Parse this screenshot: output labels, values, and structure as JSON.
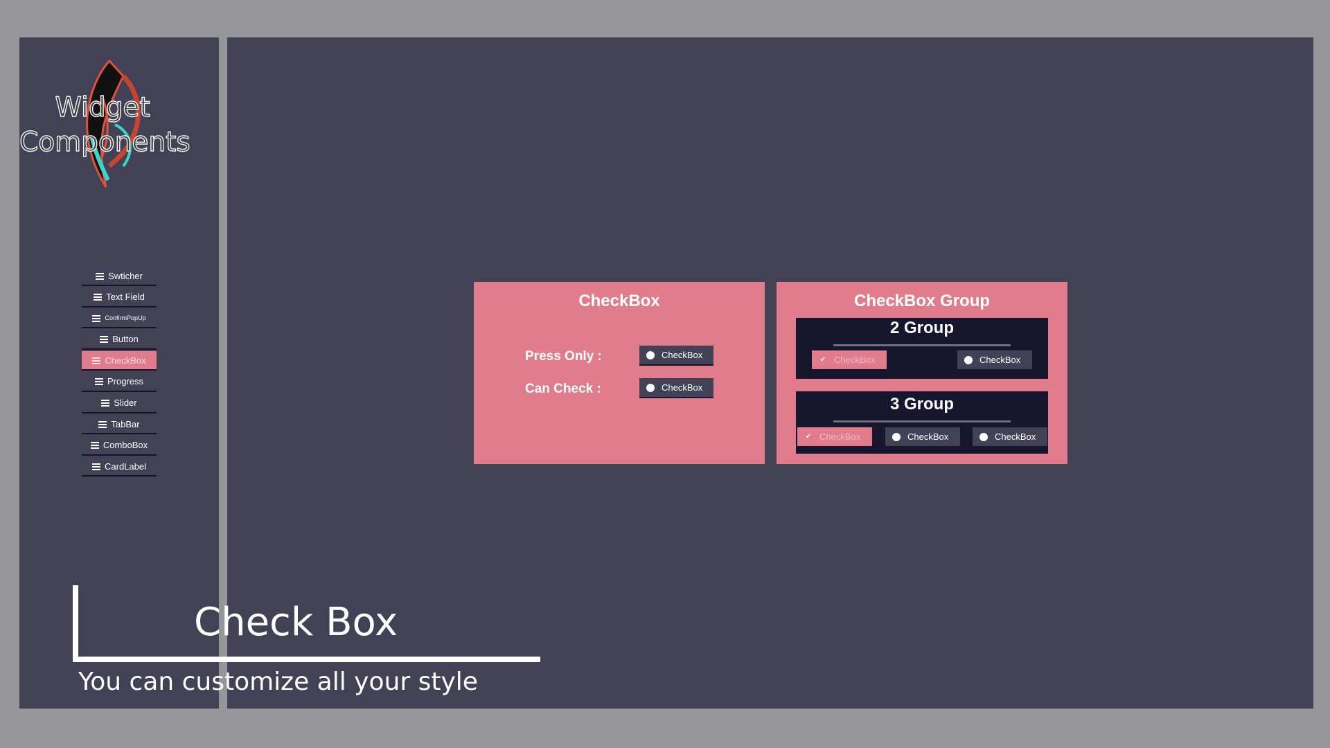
{
  "logo": {
    "line1": "Widget",
    "line2": "Components"
  },
  "menu": [
    {
      "label": "Swticher",
      "active": false
    },
    {
      "label": "Text Field",
      "active": false
    },
    {
      "label": "ConfirmPopUp",
      "active": false
    },
    {
      "label": "Button",
      "active": false
    },
    {
      "label": "CheckBox",
      "active": true
    },
    {
      "label": "Progress",
      "active": false
    },
    {
      "label": "Slider",
      "active": false
    },
    {
      "label": "TabBar",
      "active": false
    },
    {
      "label": "ComboBox",
      "active": false
    },
    {
      "label": "CardLabel",
      "active": false
    }
  ],
  "checkbox_card": {
    "title": "CheckBox",
    "press_only_label": "Press Only :",
    "press_only_checkbox": "CheckBox",
    "can_check_label": "Can Check :",
    "can_check_checkbox": "CheckBox"
  },
  "group_card": {
    "title": "CheckBox Group",
    "group2": {
      "title": "2 Group",
      "items": [
        "CheckBox",
        "CheckBox"
      ],
      "checked_index": 0
    },
    "group3": {
      "title": "3 Group",
      "items": [
        "CheckBox",
        "CheckBox",
        "CheckBox"
      ],
      "checked_index": 0
    }
  },
  "caption": {
    "title": "Check Box",
    "subtitle": "You can customize all your style"
  },
  "colors": {
    "accent": "#e07c8b",
    "panel": "#424155",
    "dark": "#16162e",
    "frame": "#96969a"
  }
}
